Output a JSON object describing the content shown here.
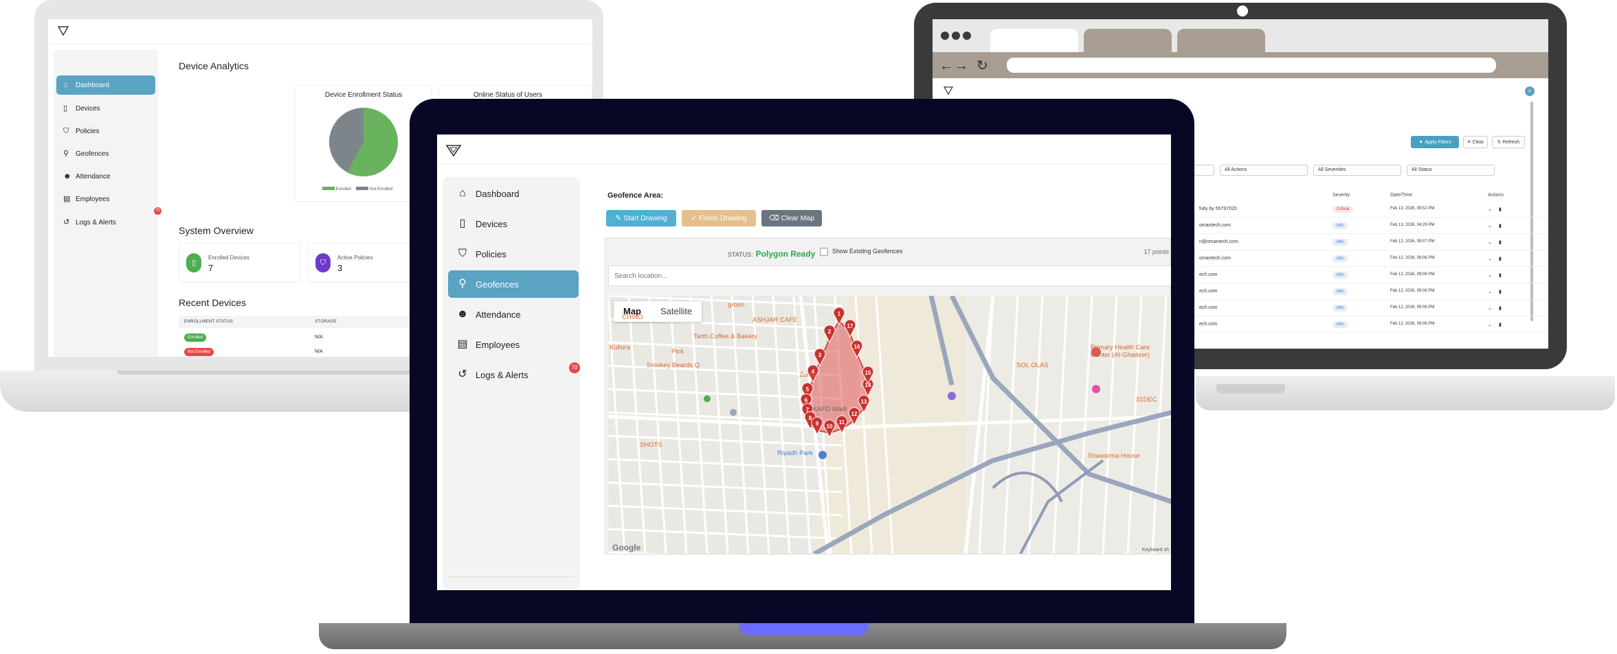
{
  "left": {
    "sidebar": [
      {
        "label": "Dashboard",
        "icon": "home-icon",
        "active": true
      },
      {
        "label": "Devices",
        "icon": "phone-icon"
      },
      {
        "label": "Policies",
        "icon": "shield-icon"
      },
      {
        "label": "Geofences",
        "icon": "pin-icon"
      },
      {
        "label": "Attendance",
        "icon": "users-icon"
      },
      {
        "label": "Employees",
        "icon": "id-card-icon"
      },
      {
        "label": "Logs & Alerts",
        "icon": "history-icon"
      }
    ],
    "badge": "70",
    "device_analytics": "Device Analytics",
    "enrollment_title": "Device Enrollment Status",
    "online_title": "Online Status of Users",
    "legend_enrolled": "Enrolled",
    "legend_not_enrolled": "Not Enrolled",
    "system_overview": "System Overview",
    "enrolled_devices_label": "Enrolled Devices",
    "enrolled_devices_value": "7",
    "active_policies_label": "Active Policies",
    "active_policies_value": "3",
    "recent_devices": "Recent Devices",
    "col_enrollment": "ENROLLMENT STATUS",
    "col_storage": "STORAGE",
    "rows": [
      {
        "status": "Enrolled",
        "storage": "N/A"
      },
      {
        "status": "Not Enrolled",
        "storage": "N/A"
      }
    ]
  },
  "right": {
    "apply": "Apply Filters",
    "clear": "Clear",
    "refresh": "Refresh",
    "filters": [
      "All Actions",
      "All Severities",
      "All Status"
    ],
    "col_severity": "Severity",
    "col_datetime": "Date/Time",
    "col_actions": "Actions",
    "rows": [
      {
        "user": "fully by 55797020",
        "sev": "Critical",
        "dt": "Feb 13, 2026, 09:52 PM"
      },
      {
        "user": "omantech.com",
        "sev": "Info",
        "dt": "Feb 13, 2026, 04:29 PM"
      },
      {
        "user": "n@omantech.com",
        "sev": "Info",
        "dt": "Feb 12, 2026, 09:07 PM"
      },
      {
        "user": "omantech.com",
        "sev": "Info",
        "dt": "Feb 12, 2026, 09:06 PM"
      },
      {
        "user": "ech.com",
        "sev": "Info",
        "dt": "Feb 12, 2026, 09:06 PM"
      },
      {
        "user": "ech.com",
        "sev": "Info",
        "dt": "Feb 12, 2026, 09:06 PM"
      },
      {
        "user": "ech.com",
        "sev": "Info",
        "dt": "Feb 12, 2026, 09:06 PM"
      },
      {
        "user": "ech.com",
        "sev": "Info",
        "dt": "Feb 12, 2026, 09:06 PM"
      }
    ]
  },
  "front": {
    "sidebar": [
      {
        "label": "Dashboard",
        "icon": "home-icon"
      },
      {
        "label": "Devices",
        "icon": "phone-icon"
      },
      {
        "label": "Policies",
        "icon": "shield-icon"
      },
      {
        "label": "Geofences",
        "icon": "pin-icon",
        "active": true
      },
      {
        "label": "Attendance",
        "icon": "users-icon"
      },
      {
        "label": "Employees",
        "icon": "id-card-icon"
      },
      {
        "label": "Logs & Alerts",
        "icon": "history-icon"
      }
    ],
    "badge": "70",
    "geofence_label": "Geofence Area:",
    "start_drawing": "Start Drawing",
    "finish_drawing": "Finish Drawing",
    "clear_map": "Clear Map",
    "status_label": "STATUS:",
    "status_value": "Polygon Ready",
    "show_existing": "Show Existing Geofences",
    "points": "17 points",
    "search_placeholder": "Search location...",
    "map_tab": "Map",
    "satellite_tab": "Satellite",
    "google": "Google",
    "keyboard": "Keyboard sh",
    "poi": [
      {
        "label": "groon"
      },
      {
        "label": "ASHJAR CAFE"
      },
      {
        "label": "CHINO"
      },
      {
        "label": "Tarth Coffee & Bakery"
      },
      {
        "label": "Kultura"
      },
      {
        "label": "Pick"
      },
      {
        "label": "Smokey Beards Q"
      },
      {
        "label": "Primary Health Care Center (Al-Ghadeer)"
      },
      {
        "label": "SOL OLAS"
      },
      {
        "label": "Zuma"
      },
      {
        "label": "KAFD Wadi"
      },
      {
        "label": "31DEC"
      },
      {
        "label": "SHOTS"
      },
      {
        "label": "Riyadh Park"
      },
      {
        "label": "Shawarma House"
      }
    ],
    "markers": [
      "1",
      "2",
      "3",
      "4",
      "5",
      "6",
      "7",
      "8",
      "9",
      "10",
      "11",
      "12",
      "13",
      "14",
      "15",
      "16",
      "17"
    ]
  },
  "colors": {
    "accent": "#5aa3c3",
    "polygon": "#e05a5a",
    "marker": "#c9332f",
    "badge": "#e54848"
  }
}
